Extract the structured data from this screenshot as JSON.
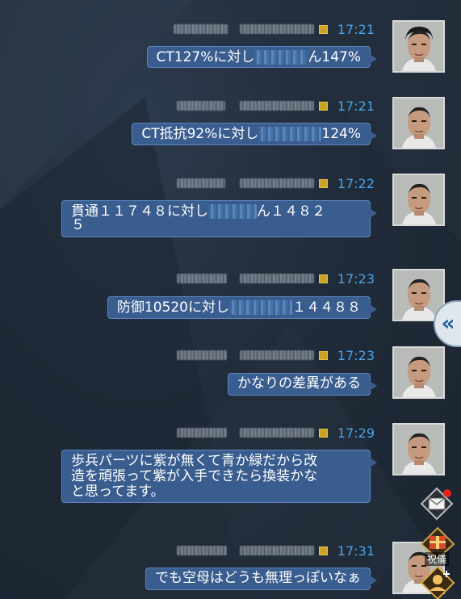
{
  "messages": [
    {
      "time": "17:21",
      "text_before": "CT127%に対し",
      "text_after": "ん147%"
    },
    {
      "time": "17:21",
      "text_before": "CT抵抗92%に対し",
      "text_after": "124%"
    },
    {
      "time": "17:22",
      "text_before": "貫通１１７４８に対し",
      "text_after": "ん１４８２\n５"
    },
    {
      "time": "17:23",
      "text_before": "防御10520に対し",
      "text_after": "１４４８８"
    },
    {
      "time": "17:23",
      "text_before": "かなりの差異がある",
      "text_after": ""
    },
    {
      "time": "17:29",
      "text_before": "歩兵パーツに紫が無くて青か緑だから改\n造を頑張って紫が入手できたら換装かな\nと思ってます。",
      "text_after": ""
    },
    {
      "time": "17:31",
      "text_before": "でも空母はどうも無理っぽいなぁ",
      "text_after": ""
    }
  ],
  "side": {
    "collapse_icon": "«",
    "gift_label": "祝儀"
  },
  "colors": {
    "time": "#4aa3e6",
    "bubble": "#3a5d8f",
    "bubble_border": "#5f86bd"
  }
}
